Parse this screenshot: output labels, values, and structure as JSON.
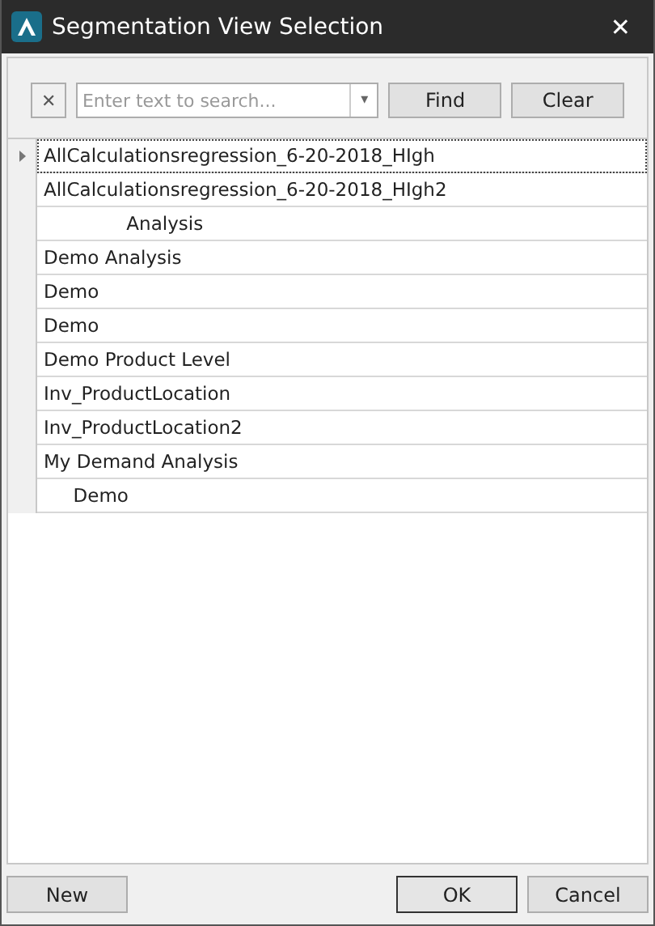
{
  "window": {
    "title": "Segmentation View Selection",
    "close": "✕"
  },
  "search": {
    "clear": "✕",
    "placeholder": "Enter text to search...",
    "dropdown": "▾",
    "find": "Find",
    "reset": "Clear"
  },
  "rows": [
    {
      "name": "AllCalculationsregression_6-20-2018_HIgh",
      "selected": true
    },
    {
      "name": "AllCalculationsregression_6-20-2018_HIgh2",
      "selected": false
    },
    {
      "name": "              Analysis",
      "selected": false
    },
    {
      "name": "Demo Analysis",
      "selected": false
    },
    {
      "name": "Demo",
      "selected": false
    },
    {
      "name": "Demo",
      "selected": false
    },
    {
      "name": "Demo Product Level",
      "selected": false
    },
    {
      "name": "Inv_ProductLocation",
      "selected": false
    },
    {
      "name": "Inv_ProductLocation2",
      "selected": false
    },
    {
      "name": "My Demand Analysis",
      "selected": false
    },
    {
      "name": "     Demo",
      "selected": false
    }
  ],
  "buttons": {
    "new": "New",
    "ok": "OK",
    "cancel": "Cancel"
  }
}
